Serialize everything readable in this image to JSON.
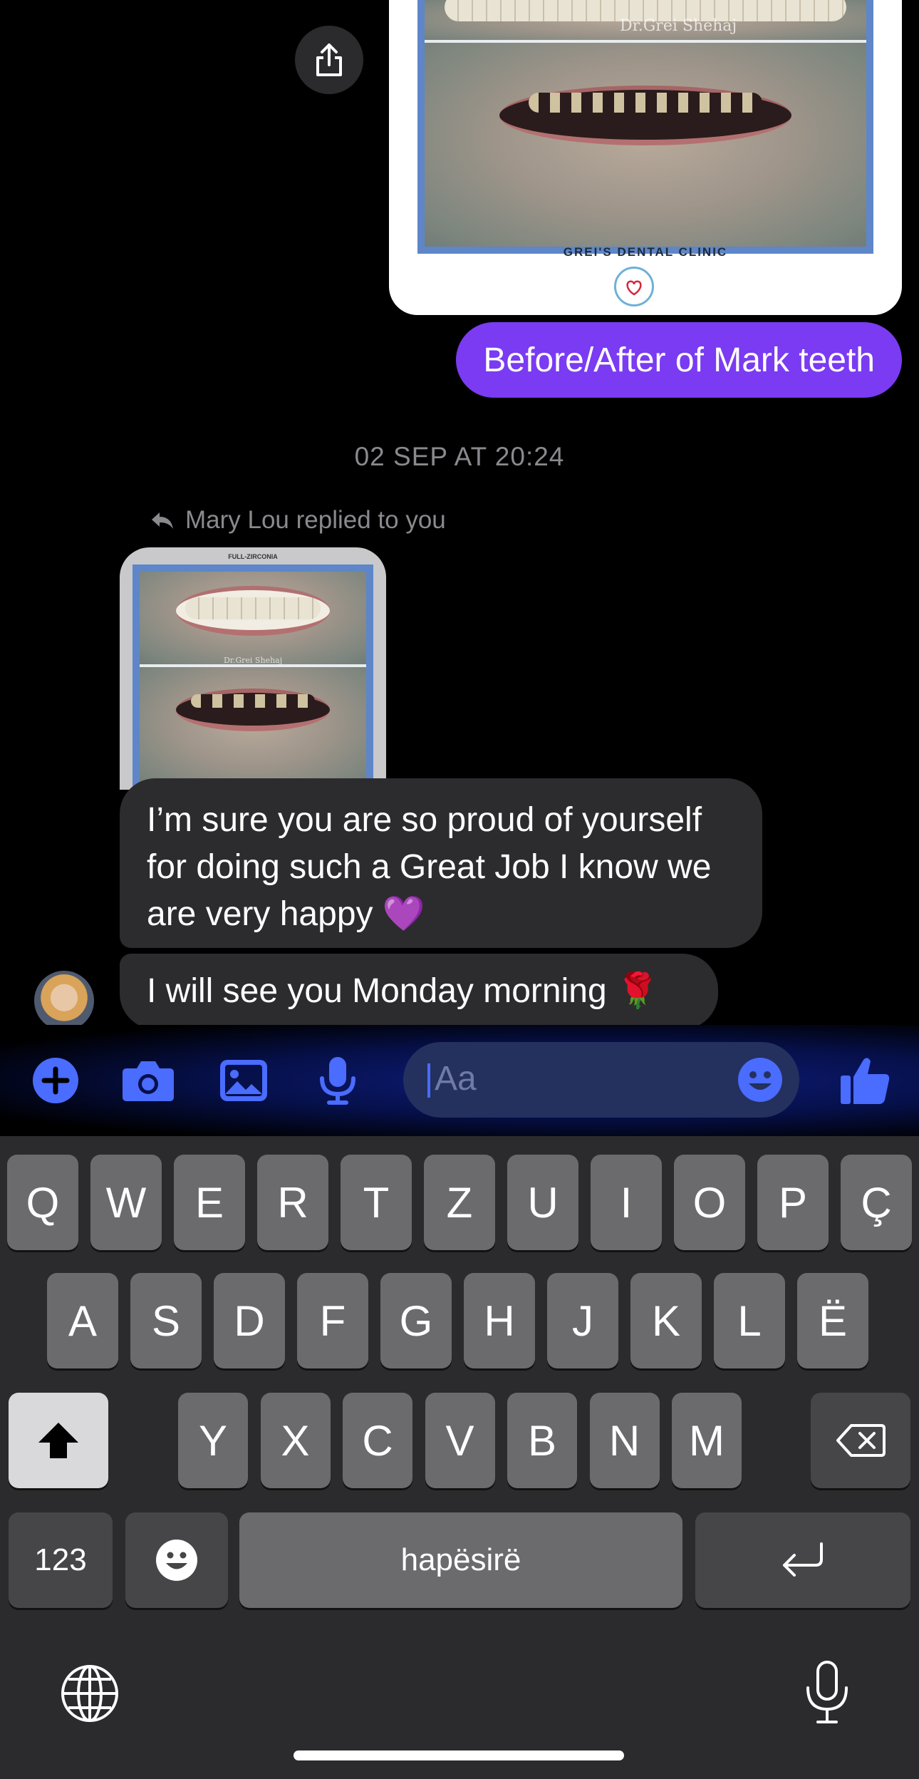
{
  "conversation": {
    "image_watermark": "Dr.Grei Shehaj",
    "clinic_name": "GREI'S DENTAL CLINIC",
    "outgoing_message": "Before/After of Mark teeth",
    "timestamp": "02 SEP AT 20:24",
    "reply_note": "Mary Lou replied to you",
    "quoted_label": "FULL-ZIRCONIA",
    "quoted_watermark": "Dr.Grei Shehaj",
    "incoming_messages": [
      "I’m sure you are so proud of yourself for doing such a Great Job I know we are very happy 💜",
      "I will see you Monday morning 🌹"
    ]
  },
  "composer": {
    "placeholder": "Aa",
    "icons": [
      "plus-icon",
      "camera-icon",
      "gallery-icon",
      "microphone-icon",
      "emoji-icon",
      "thumbs-up-icon"
    ],
    "accent": "#4a6cff"
  },
  "keyboard": {
    "row1": [
      "Q",
      "W",
      "E",
      "R",
      "T",
      "Z",
      "U",
      "I",
      "O",
      "P",
      "Ç"
    ],
    "row2": [
      "A",
      "S",
      "D",
      "F",
      "G",
      "H",
      "J",
      "K",
      "L",
      "Ë"
    ],
    "row3": [
      "Y",
      "X",
      "C",
      "V",
      "B",
      "N",
      "M"
    ],
    "numbers_label": "123",
    "space_label": "hapësirë"
  },
  "colors": {
    "outgoing_bubble": "#7a3bf2",
    "incoming_bubble": "#2c2c2e",
    "background": "#000000"
  }
}
